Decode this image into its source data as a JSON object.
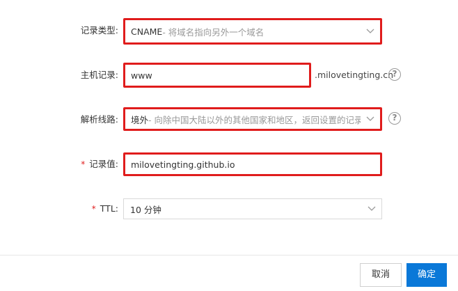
{
  "form": {
    "record_type": {
      "label": "记录类型:",
      "value": "CNAME",
      "hint": "- 将域名指向另外一个域名"
    },
    "host": {
      "label": "主机记录:",
      "value": "www",
      "suffix": ".milovetingting.cn"
    },
    "line": {
      "label": "解析线路:",
      "value": "境外",
      "hint": " - 向除中国大陆以外的其他国家和地区，返回设置的记录值"
    },
    "record_value": {
      "required": "*",
      "label": "记录值:",
      "value": "milovetingting.github.io"
    },
    "ttl": {
      "required": "*",
      "label": "TTL:",
      "value": "10 分钟"
    },
    "help_glyph": "?"
  },
  "footer": {
    "cancel_label": "取消",
    "ok_label": "确定"
  },
  "colors": {
    "highlight": "#e01c1c",
    "primary": "#0a78d8",
    "required": "#e02020"
  }
}
